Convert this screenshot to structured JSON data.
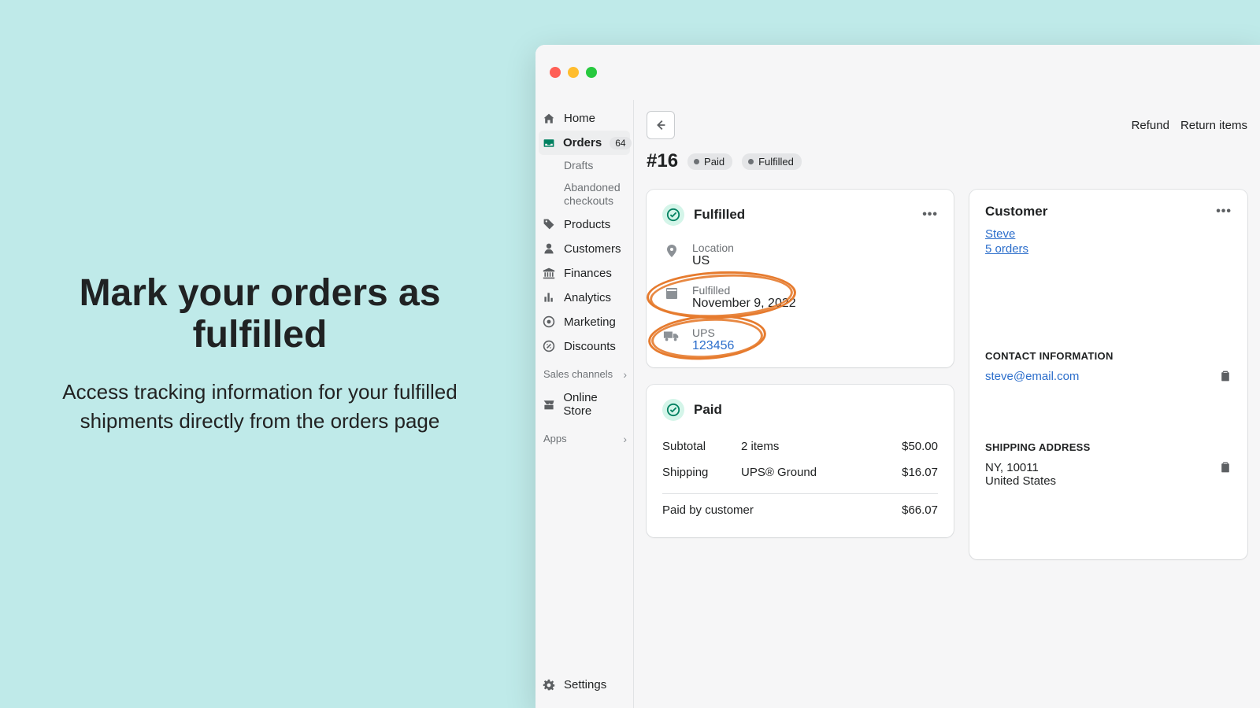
{
  "promo": {
    "title": "Mark your orders as fulfilled",
    "subtitle": "Access tracking information for your fulfilled shipments directly from the orders page"
  },
  "sidebar": {
    "items": [
      {
        "label": "Home"
      },
      {
        "label": "Orders",
        "badge": "64"
      },
      {
        "label": "Products"
      },
      {
        "label": "Customers"
      },
      {
        "label": "Finances"
      },
      {
        "label": "Analytics"
      },
      {
        "label": "Marketing"
      },
      {
        "label": "Discounts"
      }
    ],
    "orders_subs": [
      {
        "label": "Drafts"
      },
      {
        "label": "Abandoned checkouts"
      }
    ],
    "sales_channels_label": "Sales channels",
    "online_store": "Online Store",
    "apps_label": "Apps",
    "settings": "Settings"
  },
  "actions": {
    "refund": "Refund",
    "return_items": "Return items"
  },
  "order": {
    "number": "#16",
    "pill_paid": "Paid",
    "pill_fulfilled": "Fulfilled"
  },
  "fulfilled_card": {
    "title": "Fulfilled",
    "location_label": "Location",
    "location_value": "US",
    "fulfilled_label": "Fulfilled",
    "fulfilled_date": "November 9, 2022",
    "carrier": "UPS",
    "tracking": "123456"
  },
  "paid_card": {
    "title": "Paid",
    "subtotal_label": "Subtotal",
    "subtotal_qty": "2 items",
    "subtotal_amount": "$50.00",
    "shipping_label": "Shipping",
    "shipping_method": "UPS® Ground",
    "shipping_amount": "$16.07",
    "paid_by_label": "Paid by customer",
    "paid_by_amount": "$66.07"
  },
  "customer_card": {
    "title": "Customer",
    "name": "Steve",
    "orders": "5 orders",
    "contact_heading": "CONTACT INFORMATION",
    "email": "steve@email.com",
    "shipping_heading": "SHIPPING ADDRESS",
    "address_line1": "NY, 10011",
    "address_line2": "United States"
  }
}
